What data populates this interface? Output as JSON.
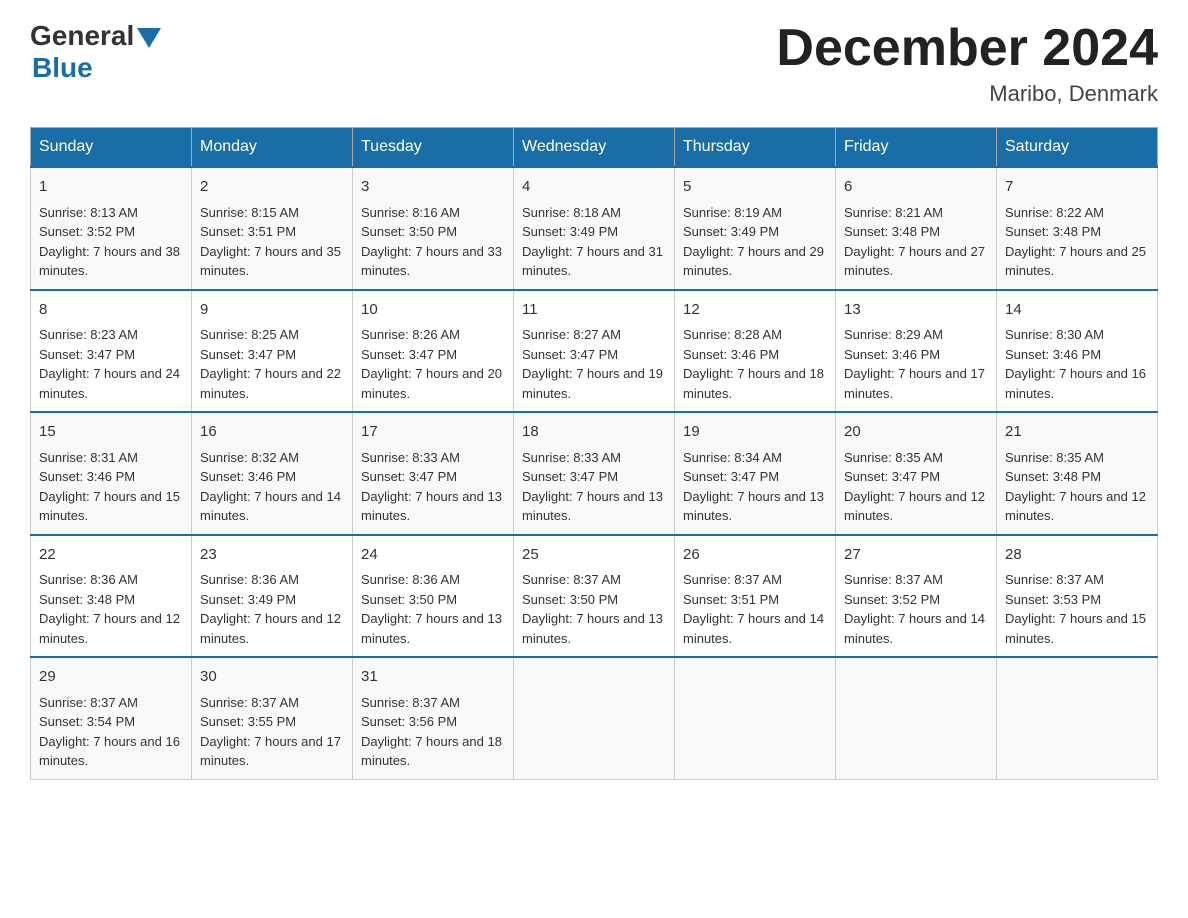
{
  "header": {
    "logo": {
      "general": "General",
      "blue": "Blue"
    },
    "title": "December 2024",
    "location": "Maribo, Denmark"
  },
  "days_of_week": [
    "Sunday",
    "Monday",
    "Tuesday",
    "Wednesday",
    "Thursday",
    "Friday",
    "Saturday"
  ],
  "weeks": [
    [
      {
        "day": 1,
        "sunrise": "8:13 AM",
        "sunset": "3:52 PM",
        "daylight": "7 hours and 38 minutes."
      },
      {
        "day": 2,
        "sunrise": "8:15 AM",
        "sunset": "3:51 PM",
        "daylight": "7 hours and 35 minutes."
      },
      {
        "day": 3,
        "sunrise": "8:16 AM",
        "sunset": "3:50 PM",
        "daylight": "7 hours and 33 minutes."
      },
      {
        "day": 4,
        "sunrise": "8:18 AM",
        "sunset": "3:49 PM",
        "daylight": "7 hours and 31 minutes."
      },
      {
        "day": 5,
        "sunrise": "8:19 AM",
        "sunset": "3:49 PM",
        "daylight": "7 hours and 29 minutes."
      },
      {
        "day": 6,
        "sunrise": "8:21 AM",
        "sunset": "3:48 PM",
        "daylight": "7 hours and 27 minutes."
      },
      {
        "day": 7,
        "sunrise": "8:22 AM",
        "sunset": "3:48 PM",
        "daylight": "7 hours and 25 minutes."
      }
    ],
    [
      {
        "day": 8,
        "sunrise": "8:23 AM",
        "sunset": "3:47 PM",
        "daylight": "7 hours and 24 minutes."
      },
      {
        "day": 9,
        "sunrise": "8:25 AM",
        "sunset": "3:47 PM",
        "daylight": "7 hours and 22 minutes."
      },
      {
        "day": 10,
        "sunrise": "8:26 AM",
        "sunset": "3:47 PM",
        "daylight": "7 hours and 20 minutes."
      },
      {
        "day": 11,
        "sunrise": "8:27 AM",
        "sunset": "3:47 PM",
        "daylight": "7 hours and 19 minutes."
      },
      {
        "day": 12,
        "sunrise": "8:28 AM",
        "sunset": "3:46 PM",
        "daylight": "7 hours and 18 minutes."
      },
      {
        "day": 13,
        "sunrise": "8:29 AM",
        "sunset": "3:46 PM",
        "daylight": "7 hours and 17 minutes."
      },
      {
        "day": 14,
        "sunrise": "8:30 AM",
        "sunset": "3:46 PM",
        "daylight": "7 hours and 16 minutes."
      }
    ],
    [
      {
        "day": 15,
        "sunrise": "8:31 AM",
        "sunset": "3:46 PM",
        "daylight": "7 hours and 15 minutes."
      },
      {
        "day": 16,
        "sunrise": "8:32 AM",
        "sunset": "3:46 PM",
        "daylight": "7 hours and 14 minutes."
      },
      {
        "day": 17,
        "sunrise": "8:33 AM",
        "sunset": "3:47 PM",
        "daylight": "7 hours and 13 minutes."
      },
      {
        "day": 18,
        "sunrise": "8:33 AM",
        "sunset": "3:47 PM",
        "daylight": "7 hours and 13 minutes."
      },
      {
        "day": 19,
        "sunrise": "8:34 AM",
        "sunset": "3:47 PM",
        "daylight": "7 hours and 13 minutes."
      },
      {
        "day": 20,
        "sunrise": "8:35 AM",
        "sunset": "3:47 PM",
        "daylight": "7 hours and 12 minutes."
      },
      {
        "day": 21,
        "sunrise": "8:35 AM",
        "sunset": "3:48 PM",
        "daylight": "7 hours and 12 minutes."
      }
    ],
    [
      {
        "day": 22,
        "sunrise": "8:36 AM",
        "sunset": "3:48 PM",
        "daylight": "7 hours and 12 minutes."
      },
      {
        "day": 23,
        "sunrise": "8:36 AM",
        "sunset": "3:49 PM",
        "daylight": "7 hours and 12 minutes."
      },
      {
        "day": 24,
        "sunrise": "8:36 AM",
        "sunset": "3:50 PM",
        "daylight": "7 hours and 13 minutes."
      },
      {
        "day": 25,
        "sunrise": "8:37 AM",
        "sunset": "3:50 PM",
        "daylight": "7 hours and 13 minutes."
      },
      {
        "day": 26,
        "sunrise": "8:37 AM",
        "sunset": "3:51 PM",
        "daylight": "7 hours and 14 minutes."
      },
      {
        "day": 27,
        "sunrise": "8:37 AM",
        "sunset": "3:52 PM",
        "daylight": "7 hours and 14 minutes."
      },
      {
        "day": 28,
        "sunrise": "8:37 AM",
        "sunset": "3:53 PM",
        "daylight": "7 hours and 15 minutes."
      }
    ],
    [
      {
        "day": 29,
        "sunrise": "8:37 AM",
        "sunset": "3:54 PM",
        "daylight": "7 hours and 16 minutes."
      },
      {
        "day": 30,
        "sunrise": "8:37 AM",
        "sunset": "3:55 PM",
        "daylight": "7 hours and 17 minutes."
      },
      {
        "day": 31,
        "sunrise": "8:37 AM",
        "sunset": "3:56 PM",
        "daylight": "7 hours and 18 minutes."
      },
      null,
      null,
      null,
      null
    ]
  ]
}
